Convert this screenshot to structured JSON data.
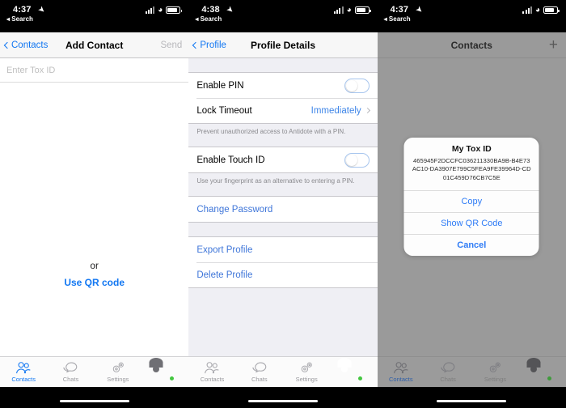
{
  "panels": [
    {
      "status": {
        "time": "4:37",
        "back_label": "Search"
      },
      "nav": {
        "back": "Contacts",
        "title": "Add Contact",
        "action": "Send"
      },
      "input": {
        "placeholder": "Enter Tox ID",
        "value": ""
      },
      "or_text": "or",
      "qr_link": "Use QR code"
    },
    {
      "status": {
        "time": "4:38",
        "back_label": "Search"
      },
      "nav": {
        "back": "Profile",
        "title": "Profile Details"
      },
      "rows": {
        "enable_pin": "Enable PIN",
        "lock_timeout": "Lock Timeout",
        "lock_timeout_value": "Immediately",
        "pin_footnote": "Prevent unauthorized access to Antidote with a PIN.",
        "enable_touch_id": "Enable Touch ID",
        "touch_footnote": "Use your fingerprint as an alternative to entering a PIN.",
        "change_password": "Change Password",
        "export_profile": "Export Profile",
        "delete_profile": "Delete Profile"
      }
    },
    {
      "status": {
        "time": "4:37",
        "back_label": "Search"
      },
      "nav": {
        "title": "Contacts",
        "add_icon": "plus-icon"
      },
      "alert": {
        "title": "My Tox ID",
        "tox_id": "465945F2DCCFC036211330BA9B-B4E73AC10-DA3907E799C5FEA9FE39964D-CD01C459D76CB7C5E",
        "buttons": [
          "Copy",
          "Show QR Code",
          "Cancel"
        ]
      }
    }
  ],
  "tabbar": {
    "items": [
      {
        "label": "Contacts",
        "icon": "contacts-icon"
      },
      {
        "label": "Chats",
        "icon": "chats-icon"
      },
      {
        "label": "Settings",
        "icon": "settings-gear-icon"
      },
      {
        "label": "",
        "icon": "profile-avatar-icon"
      }
    ]
  },
  "colors": {
    "accent": "#1277f2",
    "alert_button": "#2f7cf6",
    "status_online": "#44c740",
    "group_bg": "#efeff4"
  }
}
